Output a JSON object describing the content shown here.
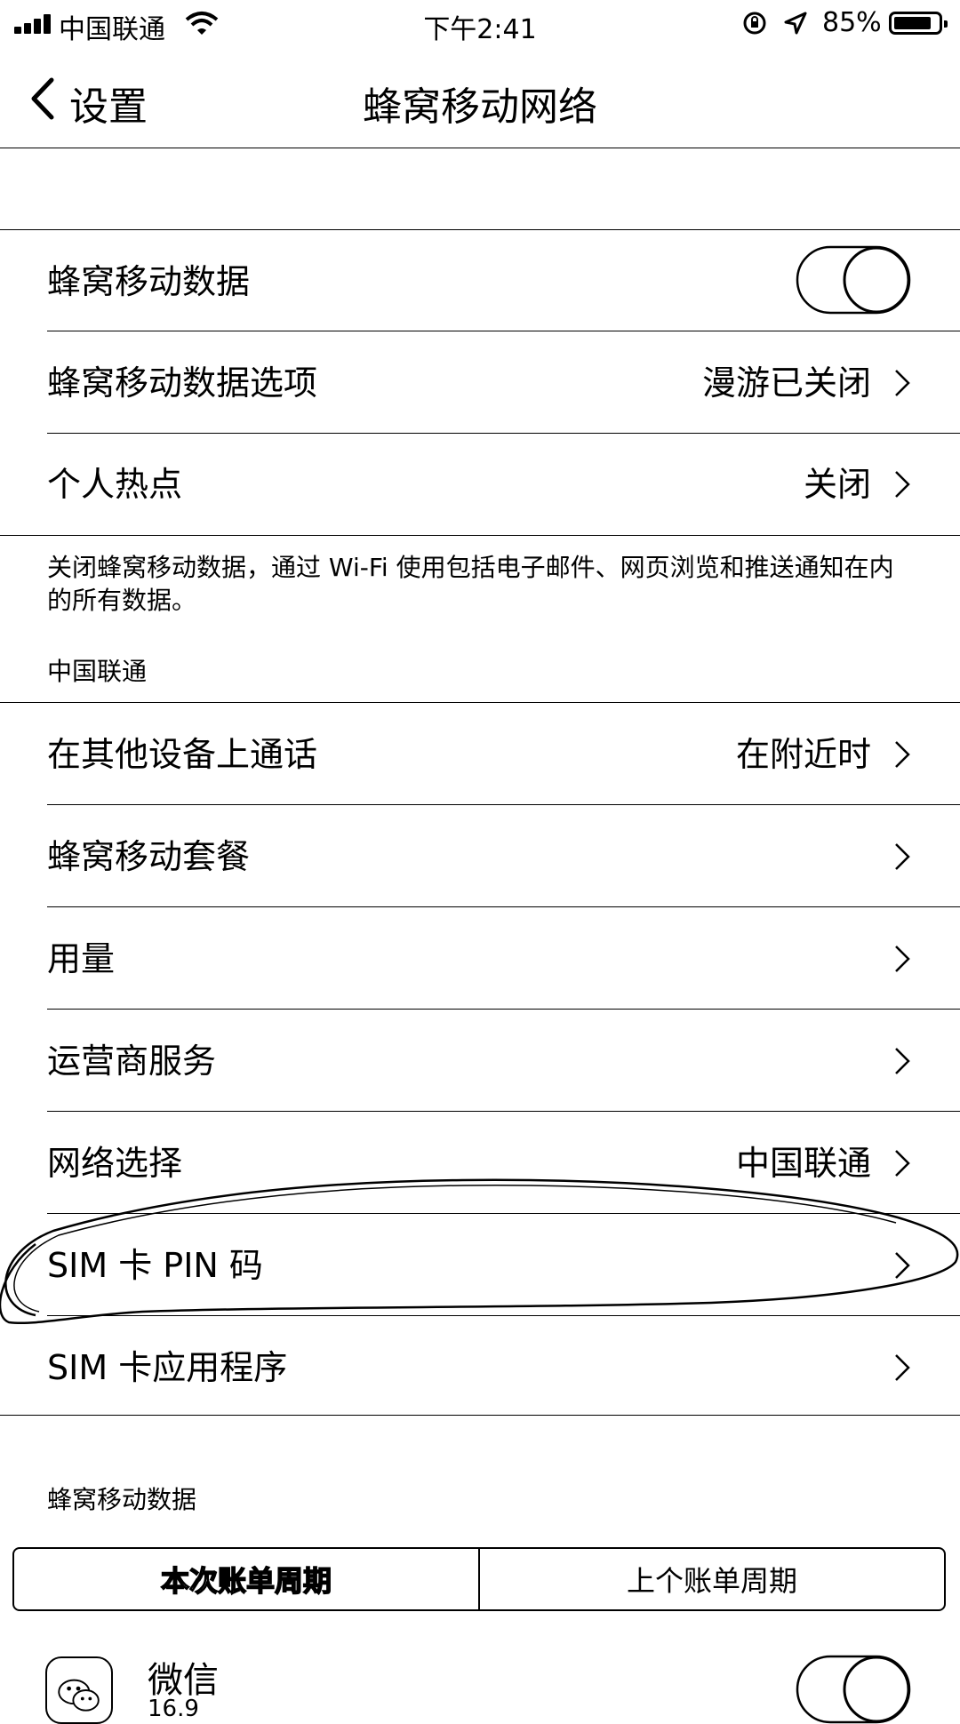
{
  "status_bar": {
    "carrier": "中国联通",
    "time": "下午2:41",
    "battery_percent_label": "85%",
    "battery_level": 0.85
  },
  "nav": {
    "back_label": "设置",
    "title": "蜂窝移动网络"
  },
  "group1": {
    "cellular_data": {
      "label": "蜂窝移动数据",
      "toggle_on": false
    },
    "cellular_options": {
      "label": "蜂窝移动数据选项",
      "value": "漫游已关闭"
    },
    "hotspot": {
      "label": "个人热点",
      "value": "关闭"
    }
  },
  "group1_footer": "关闭蜂窝移动数据，通过 Wi-Fi 使用包括电子邮件、网页浏览和推送通知在内的所有数据。",
  "group2": {
    "header": "中国联通",
    "items": [
      {
        "label": "在其他设备上通话",
        "value": "在附近时"
      },
      {
        "label": "蜂窝移动套餐",
        "value": ""
      },
      {
        "label": "用量",
        "value": ""
      },
      {
        "label": "运营商服务",
        "value": ""
      },
      {
        "label": "网络选择",
        "value": "中国联通"
      },
      {
        "label": "SIM 卡 PIN 码",
        "value": ""
      },
      {
        "label": "SIM 卡应用程序",
        "value": ""
      }
    ]
  },
  "group3": {
    "header": "蜂窝移动数据",
    "segments": [
      "本次账单周期",
      "上个账单周期"
    ],
    "selected_segment": 0,
    "app": {
      "name": "微信",
      "size": "16.9"
    }
  },
  "colors": {
    "ink": "#000000",
    "background": "#ffffff"
  }
}
